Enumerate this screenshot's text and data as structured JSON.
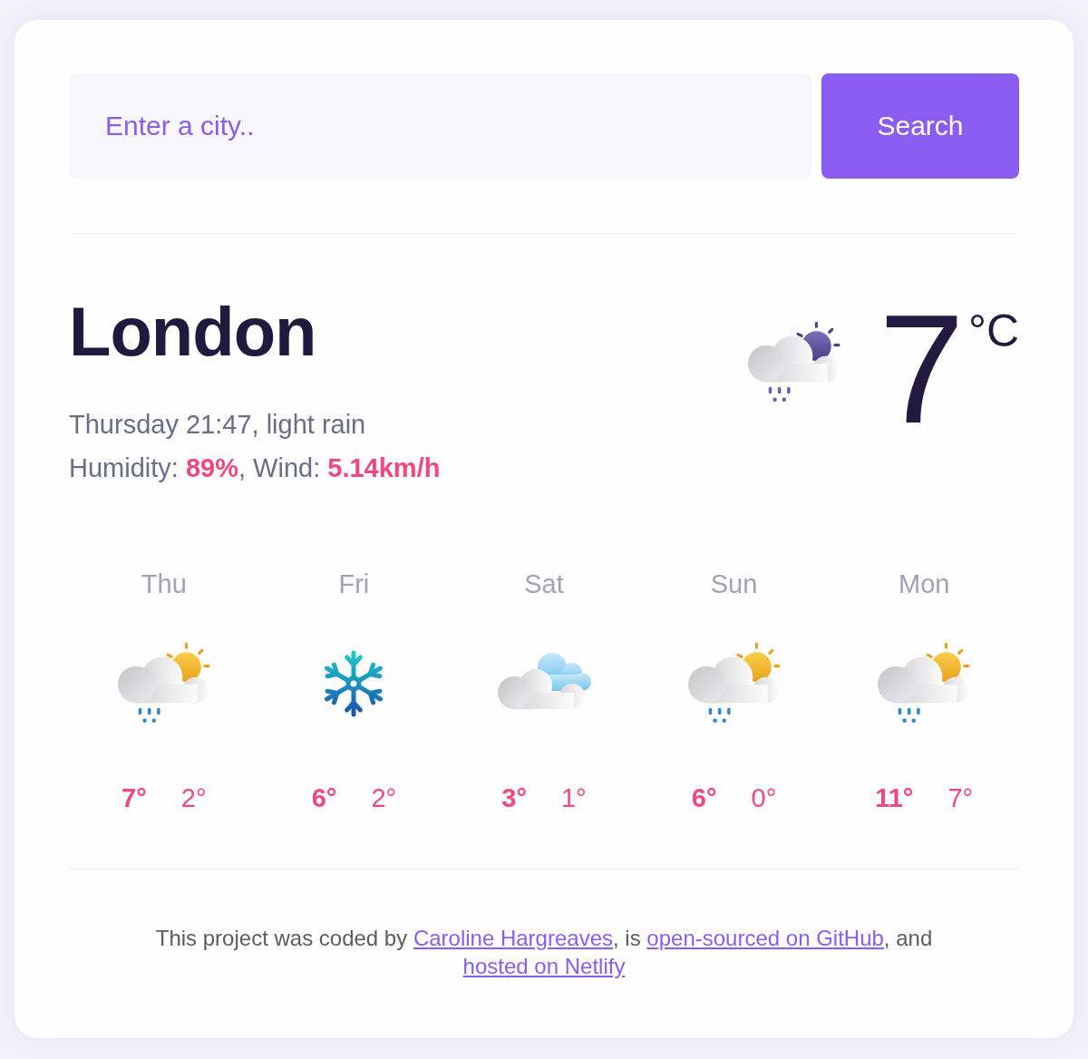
{
  "search": {
    "placeholder": "Enter a city..",
    "button": "Search"
  },
  "current": {
    "city": "London",
    "details": "Thursday 21:47, light rain",
    "conditions": "Humidity: **89%**, Wind: **5.14km/h**",
    "kind": "rain_night",
    "temperature": "7",
    "unit": "°C"
  },
  "forecast": [
    {
      "day": "Thu",
      "kind": "rain_day",
      "max": "7°",
      "min": "2°"
    },
    {
      "day": "Fri",
      "kind": "snow",
      "max": "6°",
      "min": "2°"
    },
    {
      "day": "Sat",
      "kind": "cloudy",
      "max": "3°",
      "min": "1°"
    },
    {
      "day": "Sun",
      "kind": "rain_day",
      "max": "6°",
      "min": "0°"
    },
    {
      "day": "Mon",
      "kind": "rain_day",
      "max": "11°",
      "min": "7°"
    }
  ],
  "footer": [
    {
      "kind": "text",
      "text": "This project was coded by "
    },
    {
      "kind": "link",
      "text": "Caroline Hargreaves"
    },
    {
      "kind": "text",
      "text": ", is "
    },
    {
      "kind": "link",
      "text": "open-sourced on GitHub"
    },
    {
      "kind": "text",
      "text": ", and "
    },
    {
      "kind": "link",
      "text": "hosted on Netlify"
    }
  ]
}
